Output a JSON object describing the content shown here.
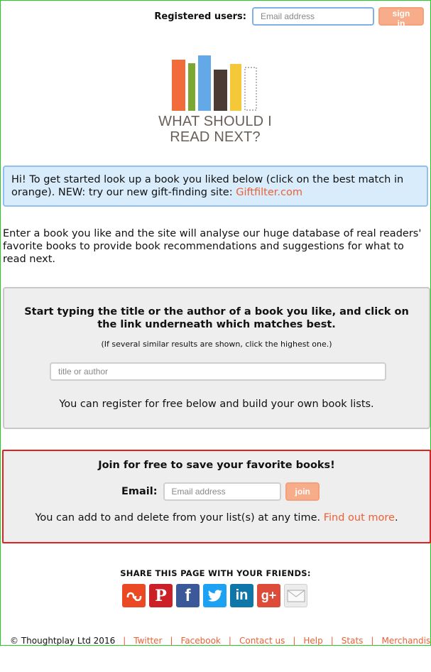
{
  "login": {
    "label": "Registered users:",
    "email_placeholder": "Email address",
    "signin_label": "sign in"
  },
  "logo": {
    "line1": "WHAT SHOULD I",
    "line2": "READ NEXT?"
  },
  "info": {
    "text": "Hi! To get started look up a book you liked below (click on the best match in orange). NEW: try our new gift-finding site: ",
    "link": "Giftfilter.com"
  },
  "intro": "Enter a book you like and the site will analyse our huge database of real readers' favorite books to provide book recommendations and suggestions for what to read next.",
  "search": {
    "heading": "Start typing the title or the author of a book you like, and click on the link underneath which matches best.",
    "hint": "(If several similar results are shown, click the highest one.)",
    "placeholder": "title or author",
    "register_note": "You can register for free below and build your own book lists."
  },
  "join": {
    "heading": "Join for free to save your favorite books!",
    "email_label": "Email:",
    "email_placeholder": "Email address",
    "join_label": "join",
    "note": "You can add to and delete from your list(s) at any time. ",
    "note_link": "Find out more",
    "note_end": "."
  },
  "share": {
    "title": "SHARE THIS PAGE WITH YOUR FRIENDS:",
    "icons": [
      {
        "name": "stumbleupon-icon",
        "glyph": "su",
        "color": "#eb4924"
      },
      {
        "name": "pinterest-icon",
        "glyph": "P",
        "color": "#cb2027"
      },
      {
        "name": "facebook-icon",
        "glyph": "f",
        "color": "#3b5998"
      },
      {
        "name": "twitter-icon",
        "glyph": "t",
        "color": "#1da1f2"
      },
      {
        "name": "linkedin-icon",
        "glyph": "in",
        "color": "#0e76a8"
      },
      {
        "name": "googleplus-icon",
        "glyph": "g+",
        "color": "#dd4b39"
      },
      {
        "name": "email-icon",
        "glyph": "✉",
        "color": "#e6e6e6"
      }
    ]
  },
  "footer": {
    "copyright": "© Thoughtplay Ltd 2016",
    "links": [
      "Twitter",
      "Facebook",
      "Contact us",
      "Help",
      "Stats",
      "Merchandise"
    ]
  },
  "colors": {
    "accent": "#ee5f32",
    "info_bg": "#d9ecfb",
    "book_colors": [
      "#f26b3a",
      "#7aa832",
      "#63a9e8",
      "#4b3b35",
      "#f4c838"
    ]
  }
}
